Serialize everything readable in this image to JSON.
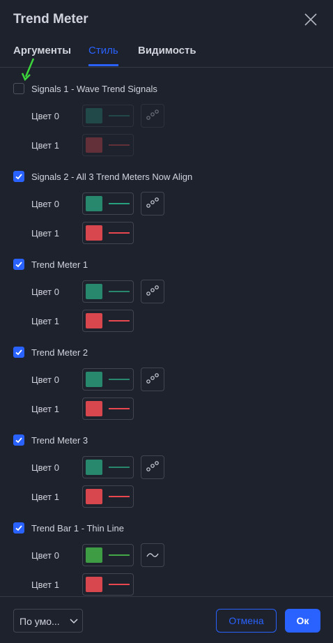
{
  "dialog": {
    "title": "Trend Meter"
  },
  "tabs": [
    {
      "label": "Аргументы",
      "active": false
    },
    {
      "label": "Стиль",
      "active": true
    },
    {
      "label": "Видимость",
      "active": false
    }
  ],
  "groups": [
    {
      "label": "Signals 1 - Wave Trend Signals",
      "checked": false,
      "colors": [
        {
          "label": "Цвет 0",
          "swatch": "#26796b",
          "line": "#26796b",
          "style_icon": "circles"
        },
        {
          "label": "Цвет 1",
          "swatch": "#b83f47",
          "line": "#b83f47"
        }
      ]
    },
    {
      "label": "Signals 2 - All 3 Trend Meters Now Align",
      "checked": true,
      "colors": [
        {
          "label": "Цвет 0",
          "swatch": "#27886e",
          "line": "#27a17d",
          "style_icon": "circles"
        },
        {
          "label": "Цвет 1",
          "swatch": "#d9474e",
          "line": "#e9484f"
        }
      ]
    },
    {
      "label": "Trend Meter 1",
      "checked": true,
      "colors": [
        {
          "label": "Цвет 0",
          "swatch": "#27886e",
          "line": "#27886e",
          "style_icon": "circles"
        },
        {
          "label": "Цвет 1",
          "swatch": "#d9474e",
          "line": "#e9484f"
        }
      ]
    },
    {
      "label": "Trend Meter 2",
      "checked": true,
      "colors": [
        {
          "label": "Цвет 0",
          "swatch": "#27886e",
          "line": "#27886e",
          "style_icon": "circles"
        },
        {
          "label": "Цвет 1",
          "swatch": "#d9474e",
          "line": "#e9484f"
        }
      ]
    },
    {
      "label": "Trend Meter 3",
      "checked": true,
      "colors": [
        {
          "label": "Цвет 0",
          "swatch": "#27886e",
          "line": "#27886e",
          "style_icon": "circles"
        },
        {
          "label": "Цвет 1",
          "swatch": "#d9474e",
          "line": "#e9484f"
        }
      ]
    },
    {
      "label": "Trend Bar 1 - Thin Line",
      "checked": true,
      "colors": [
        {
          "label": "Цвет 0",
          "swatch": "#3e9c44",
          "line": "#43a947",
          "style_icon": "wave"
        },
        {
          "label": "Цвет 1",
          "swatch": "#d9474e",
          "line": "#e9484f"
        }
      ]
    }
  ],
  "footer": {
    "defaults_label": "По умо...",
    "cancel_label": "Отмена",
    "ok_label": "Ок"
  },
  "colors": {
    "accent": "#2962ff",
    "background": "#1e222d",
    "border": "#434651",
    "annotation_arrow": "#3cd63c"
  }
}
